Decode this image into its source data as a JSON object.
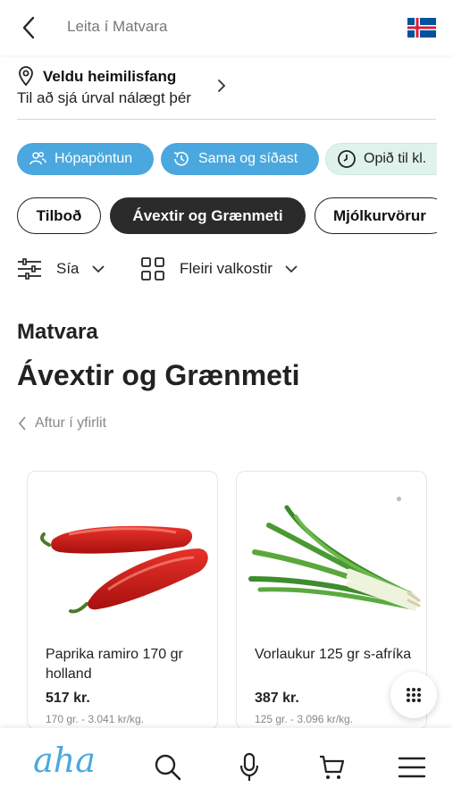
{
  "header": {
    "search_placeholder": "Leita í Matvara",
    "back_icon": "chevron-left-icon",
    "flag_icon": "iceland-flag-icon",
    "colors": {
      "flag_blue": "#02529C",
      "flag_red": "#DC1E35"
    }
  },
  "address": {
    "title": "Veldu heimilisfang",
    "subtitle": "Til að sjá úrval nálægt þér"
  },
  "quick_pills": [
    {
      "label": "Hópapöntun",
      "icon": "group-icon"
    },
    {
      "label": "Sama og síðast",
      "icon": "reorder-clock-icon"
    },
    {
      "label": "Opið til kl.",
      "icon": "clock-icon"
    }
  ],
  "categories": [
    {
      "label": "Tilboð",
      "active": false
    },
    {
      "label": "Ávextir og Grænmeti",
      "active": true
    },
    {
      "label": "Mjólkurvörur",
      "active": false
    }
  ],
  "filters": {
    "filter_label": "Sía",
    "more_label": "Fleiri valkostir"
  },
  "main": {
    "section": "Matvara",
    "title": "Ávextir og Grænmeti",
    "back_link": "Aftur í yfirlit"
  },
  "products": [
    {
      "name": "Paprika ramiro 170 gr holland",
      "price": "517 kr.",
      "unit": "170 gr. - 3.041 kr/kg.",
      "image": "red-pepper-image"
    },
    {
      "name": "Vorlaukur 125 gr s-afríka",
      "price": "387 kr.",
      "unit": "125 gr. - 3.096 kr/kg.",
      "image": "spring-onion-image"
    }
  ],
  "bottom_nav": {
    "logo": "aha",
    "items": [
      "search-icon",
      "microphone-icon",
      "cart-icon",
      "menu-icon"
    ]
  },
  "colors": {
    "accent_blue": "#4aa8df",
    "mint": "#dff3ec",
    "dark_chip": "#2b2b2b"
  }
}
